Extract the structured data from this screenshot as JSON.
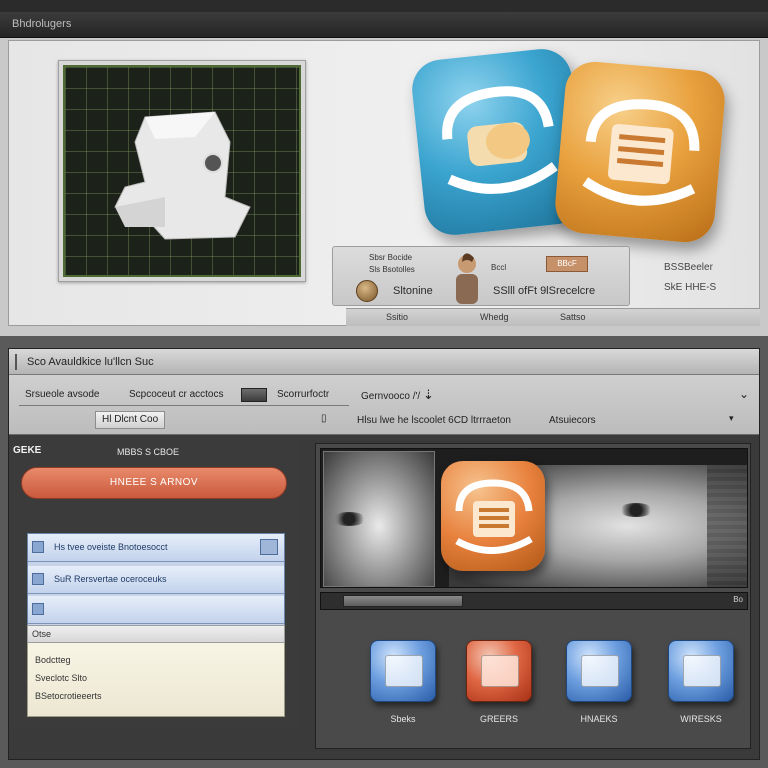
{
  "top_window": {
    "title": "Bhdrolugers"
  },
  "info_card": {
    "line1": "Sbsr Bocide",
    "line2": "Sls Bsotolles",
    "name": "Sltonine",
    "badge_left": "Bccl",
    "badge": "BBcF",
    "detail": "SSlll ofFt 9lSrecelcre",
    "side_top": "BSSBeeler",
    "side_bottom": "SkE HHE-S"
  },
  "info_footer": [
    "Ssitio",
    "Whedg",
    "Sattso"
  ],
  "bottom_window": {
    "title": "Sco Avauldkice lu'llcn Suc",
    "toolbar": {
      "item1": "Srsueole avsode",
      "item2": "Scpcoceut cr acctocs",
      "item3": "Scorrurfoctr",
      "item4": "Gernvooco /'/",
      "button1": "Hl Dlcnt Coo",
      "item5": "Hlsu lwe he lscoolet 6CD ltrrraeton",
      "item6": "Atsuiecors"
    }
  },
  "left_panel": {
    "heading": "GEKE",
    "subheading": "MBBS S CBOE",
    "primary_button": "HNEEE S ARNOV",
    "list_items": [
      "Hs tvee oveiste Bnotoesocct",
      "SuR Rersvertae oceroceuks",
      ""
    ],
    "notes_title": "Otse",
    "notes": [
      "Bodctteg",
      "Sveclotc Slto",
      "BSetocrotieeerts"
    ]
  },
  "player": {
    "time": "Bo"
  },
  "tiles": [
    {
      "label": "Sbeks",
      "style": "blue"
    },
    {
      "label": "GREERS",
      "style": "red"
    },
    {
      "label": "HNAEKS",
      "style": "blue"
    },
    {
      "label": "WIRESKS",
      "style": "blue"
    }
  ],
  "colors": {
    "accent_orange": "#e8813d",
    "accent_blue": "#3aa4cf",
    "primary_button": "#d96a4c"
  }
}
